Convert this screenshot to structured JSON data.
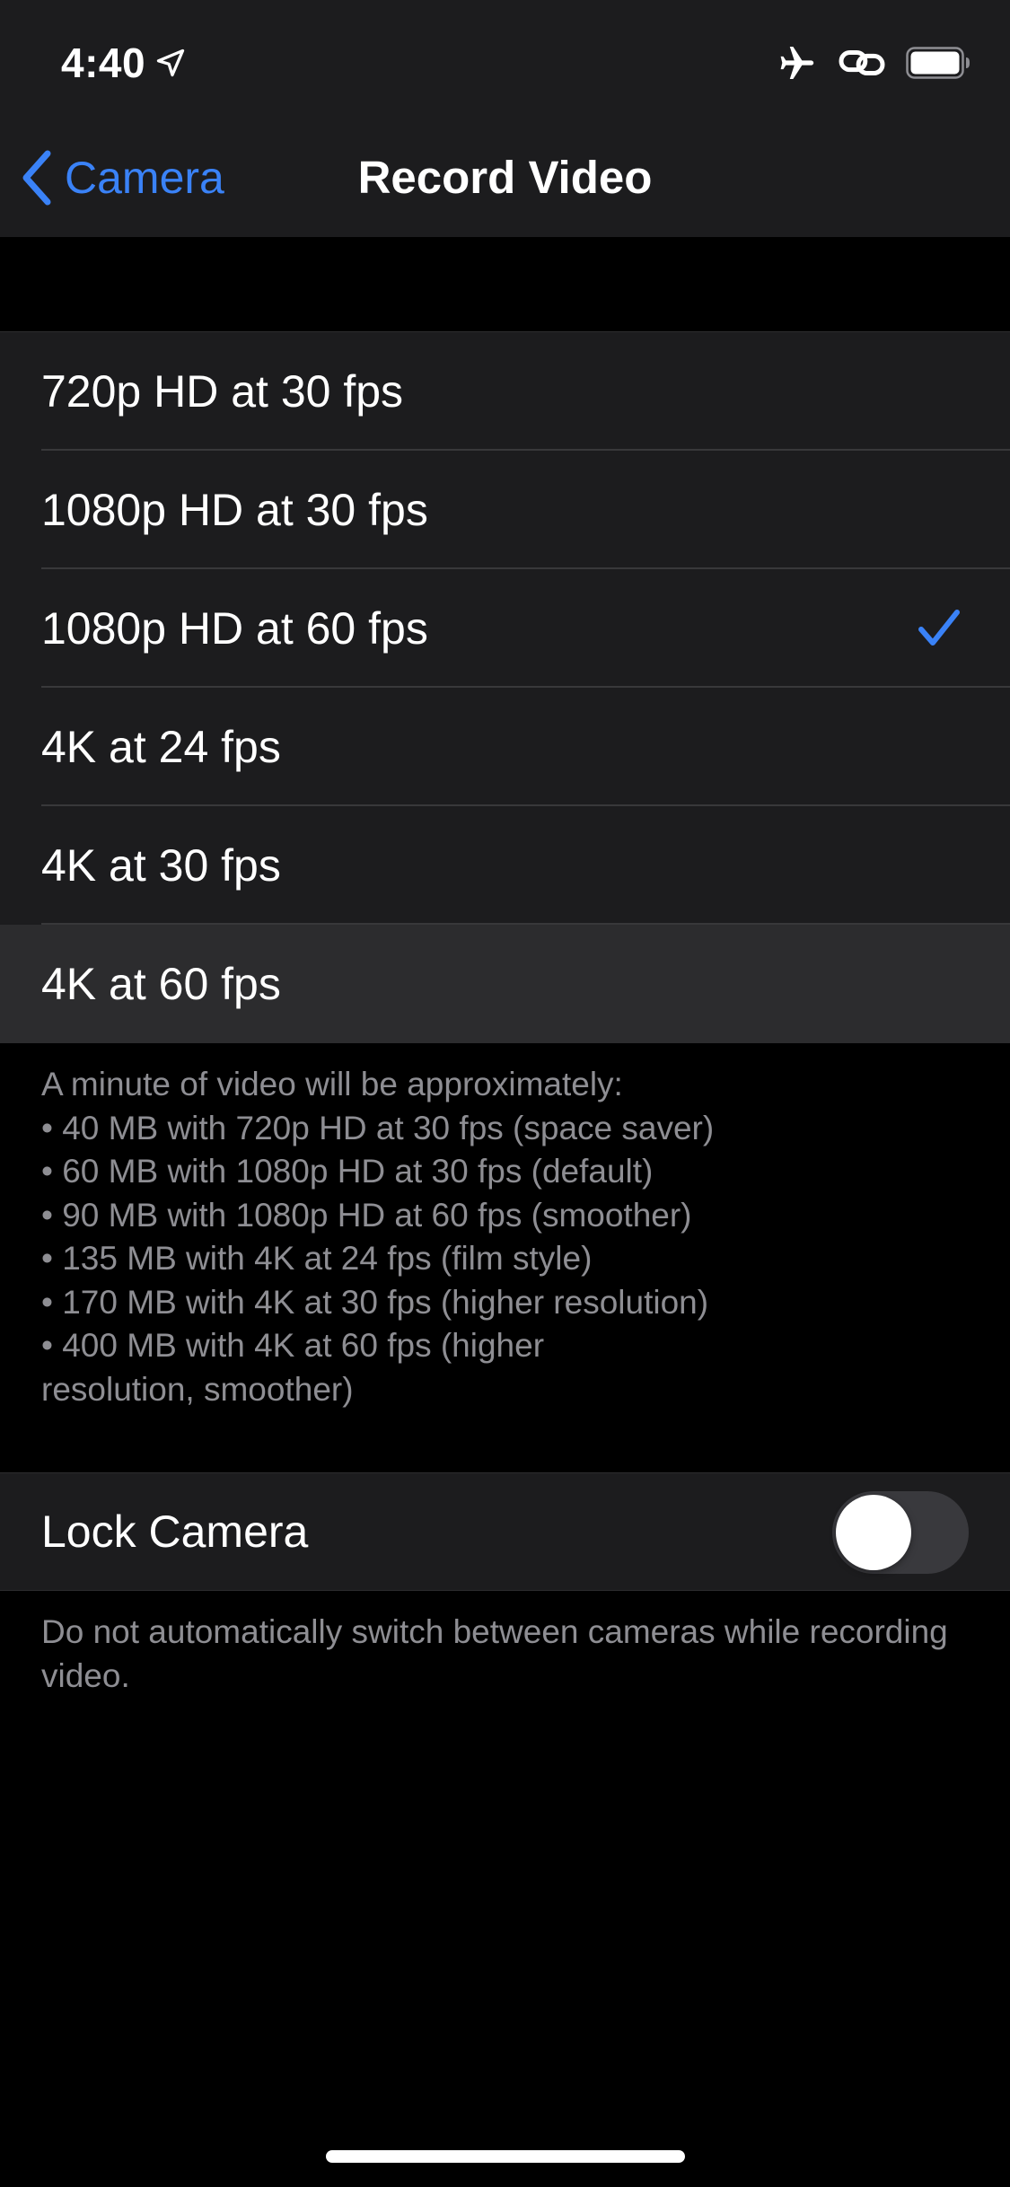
{
  "status_bar": {
    "time": "4:40"
  },
  "nav": {
    "back_label": "Camera",
    "title": "Record Video"
  },
  "options": [
    {
      "label": "720p HD at 30 fps",
      "selected": false
    },
    {
      "label": "1080p HD at 30 fps",
      "selected": false
    },
    {
      "label": "1080p HD at 60 fps",
      "selected": true
    },
    {
      "label": "4K at 24 fps",
      "selected": false
    },
    {
      "label": "4K at 30 fps",
      "selected": false
    },
    {
      "label": "4K at 60 fps",
      "selected": false
    }
  ],
  "footer_note": "A minute of video will be approximately:\n• 40 MB with 720p HD at 30 fps (space saver)\n• 60 MB with 1080p HD at 30 fps (default)\n• 90 MB with 1080p HD at 60 fps (smoother)\n• 135 MB with 4K at 24 fps (film style)\n• 170 MB with 4K at 30 fps (higher resolution)\n• 400 MB with 4K at 60 fps (higher\nresolution, smoother)",
  "lock_camera": {
    "label": "Lock Camera",
    "enabled": false,
    "note": "Do not automatically switch between cameras while recording video."
  },
  "colors": {
    "accent": "#3a82f7",
    "background": "#000000",
    "group_background": "#1c1c1e",
    "secondary_text": "#8e8e93"
  },
  "icons": {
    "status": [
      "location-arrow-icon",
      "airplane-icon",
      "link-icon",
      "battery-icon"
    ],
    "back": "chevron-left-icon",
    "selection": "checkmark-icon"
  }
}
